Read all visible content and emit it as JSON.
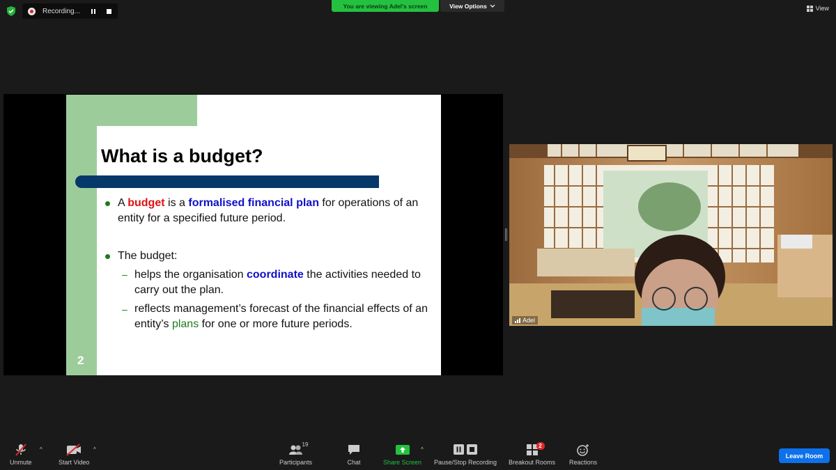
{
  "top": {
    "recording_label": "Recording...",
    "viewing_banner": "You are viewing Adel's screen",
    "view_options": "View Options",
    "view_button": "View"
  },
  "slide": {
    "title": "What is a budget?",
    "bullet1": {
      "prefix": "A ",
      "kw1": "budget",
      "mid": " is a ",
      "kw2": "formalised financial plan",
      "suffix": " for operations of an entity for a specified future period."
    },
    "bullet2": "The budget:",
    "sub1": {
      "prefix": "helps the organisation ",
      "kw": "coordinate",
      "suffix": " the activities needed to carry out the plan."
    },
    "sub2": {
      "prefix": "reflects management’s forecast of the financial effects of an entity’s ",
      "kw": "plans",
      "suffix": " for one or more future periods."
    },
    "page_number": "2"
  },
  "video": {
    "participant_name": "Adel"
  },
  "toolbar": {
    "unmute": "Unmute",
    "start_video": "Start Video",
    "participants": "Participants",
    "participants_count": "19",
    "chat": "Chat",
    "share_screen": "Share Screen",
    "pause_stop_recording": "Pause/Stop Recording",
    "breakout_rooms": "Breakout Rooms",
    "breakout_badge": "2",
    "reactions": "Reactions",
    "leave_room": "Leave Room"
  },
  "colors": {
    "share_green": "#24c140",
    "leave_blue": "#0e71eb",
    "slide_green": "#9dcc9b",
    "slide_bar": "#06386a"
  }
}
